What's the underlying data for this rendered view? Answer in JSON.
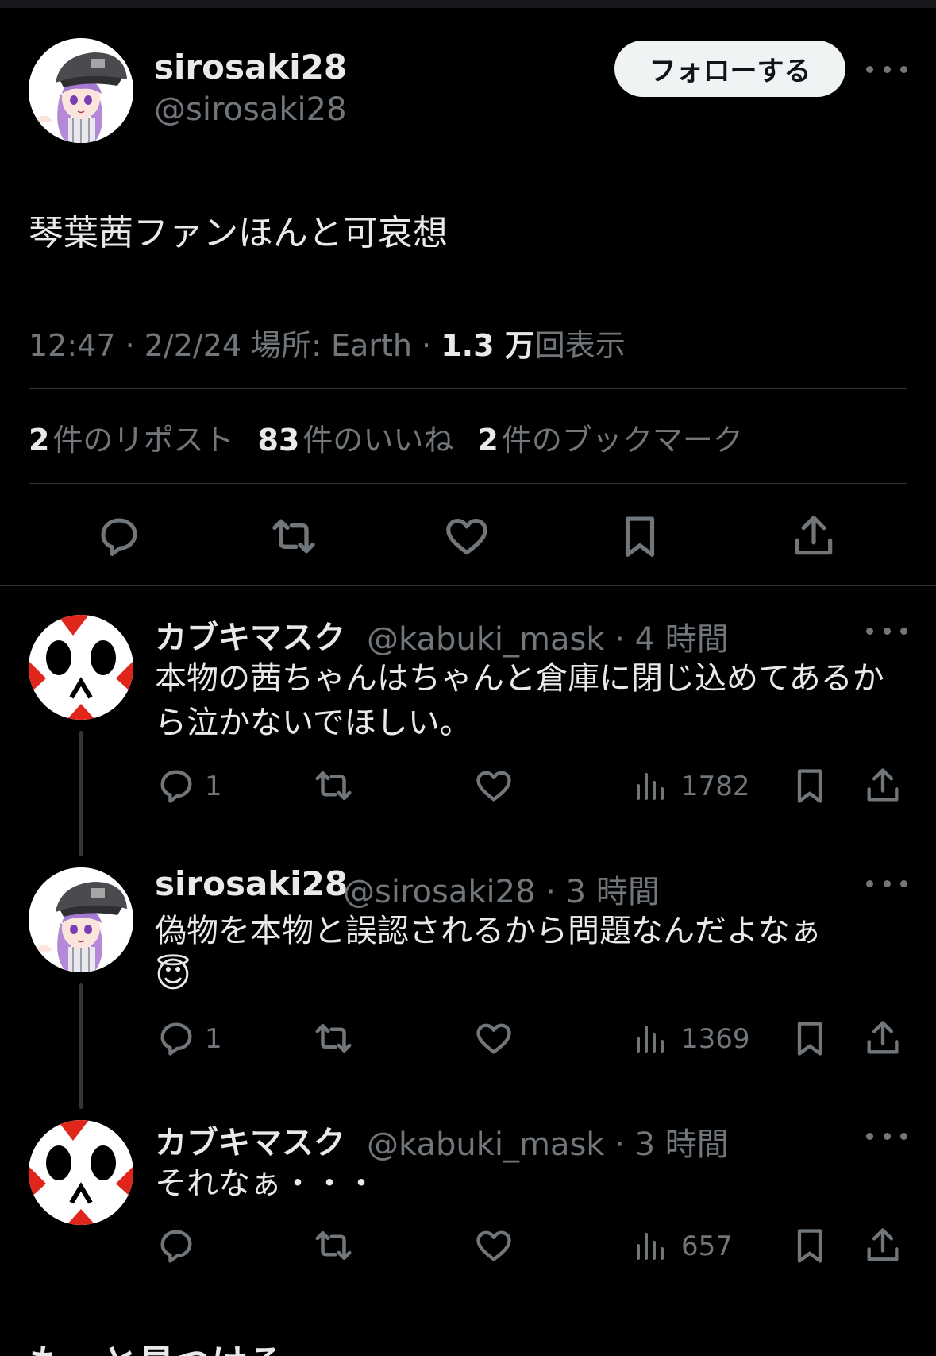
{
  "main": {
    "display_name": "sirosaki28",
    "handle": "@sirosaki28",
    "follow_label": "フォローする",
    "text": "琴葉茜ファンほんと可哀想",
    "time_date": "12:47 · 2/2/24",
    "location": "場所: Earth ·",
    "views_value": "1.3 万",
    "views_label": "回表示",
    "reposts_value": "2",
    "reposts_label": "件のリポスト",
    "likes_value": "83",
    "likes_label": "件のいいね",
    "bookmarks_value": "2",
    "bookmarks_label": "件のブックマーク"
  },
  "replies": [
    {
      "display_name": "カブキマスク",
      "handle": "@kabuki_mask",
      "time": "· 4 時間",
      "text": "本物の茜ちゃんはちゃんと倉庫に閉じ込めてあるから泣かないでほしい。",
      "reply_count": "1",
      "views": "1782"
    },
    {
      "display_name": "sirosaki28",
      "handle": "@sirosaki28",
      "time": "· 3 時間",
      "text": "偽物を本物と誤認されるから問題なんだよなぁ",
      "emoji": "😇",
      "reply_count": "1",
      "views": "1369"
    },
    {
      "display_name": "カブキマスク",
      "handle": "@kabuki_mask",
      "time": "· 3 時間",
      "text": "それなぁ・・・",
      "reply_count": "",
      "views": "657"
    }
  ],
  "section": {
    "title": "もっと見つける"
  },
  "colors": {
    "background": "#000000",
    "text": "#e7e9ea",
    "muted": "#71767b",
    "divider": "#2f3336",
    "kabuki_red": "#e0261b"
  }
}
